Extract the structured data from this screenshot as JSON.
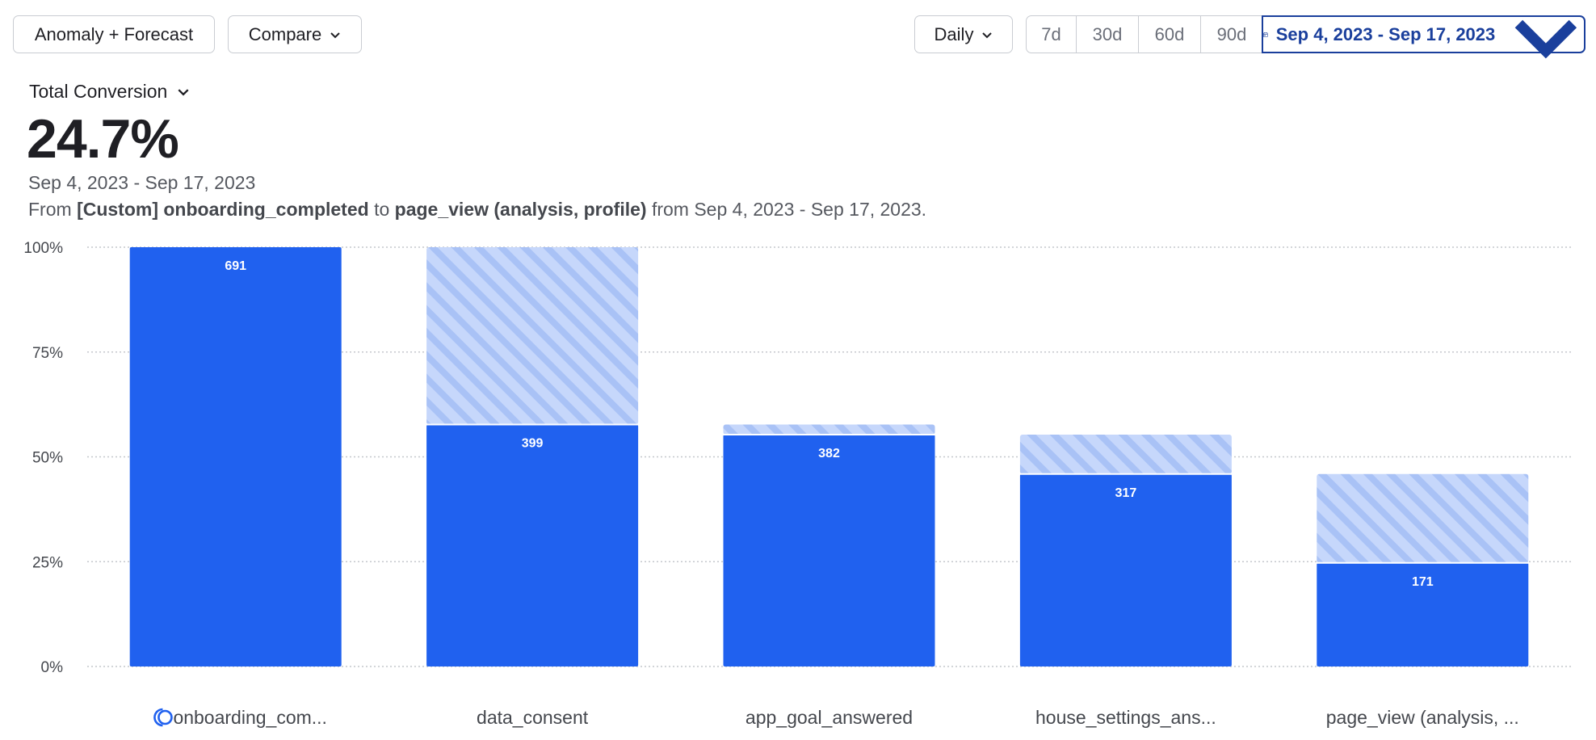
{
  "toolbar": {
    "anomaly_label": "Anomaly + Forecast",
    "compare_label": "Compare",
    "interval_label": "Daily",
    "ranges": [
      "7d",
      "30d",
      "60d",
      "90d"
    ],
    "date_range_label": "Sep 4, 2023 - Sep 17, 2023"
  },
  "summary": {
    "metric_label": "Total Conversion",
    "value": "24.7%",
    "date_range": "Sep 4, 2023 - Sep 17, 2023",
    "desc_from": "From",
    "desc_start_event": "[Custom] onboarding_completed",
    "desc_to": "to",
    "desc_end_event": "page_view (analysis, profile)",
    "desc_suffix": "from Sep 4, 2023 - Sep 17, 2023."
  },
  "colors": {
    "bar": "#2061ef",
    "stripe_light": "#c6d7fb",
    "stripe_dark": "#a9c2f6",
    "accent": "#1a3f9c"
  },
  "chart_data": {
    "type": "bar",
    "categories": [
      "onboarding_com...",
      "data_consent",
      "app_goal_answered",
      "house_settings_ans...",
      "page_view (analysis, ..."
    ],
    "converted_percent": [
      100,
      57.7,
      55.3,
      45.9,
      24.7
    ],
    "dropoff_top_percent": [
      100,
      100,
      57.7,
      55.3,
      45.9
    ],
    "counts": [
      "691",
      "399",
      "382",
      "317",
      "171"
    ],
    "y_ticks": [
      "0%",
      "25%",
      "50%",
      "75%",
      "100%"
    ],
    "ylim": [
      0,
      100
    ],
    "grid": true,
    "first_category_icon": "custom-event-icon"
  }
}
